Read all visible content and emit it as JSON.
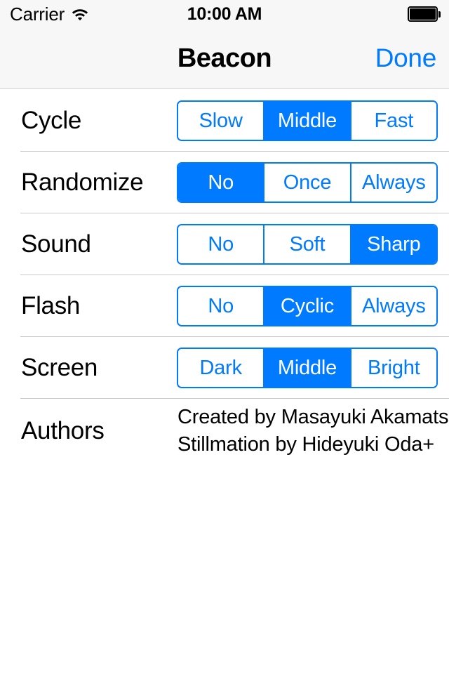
{
  "status_bar": {
    "carrier": "Carrier",
    "wifi_icon": "wifi-icon",
    "time": "10:00 AM",
    "battery_icon": "battery-full-icon"
  },
  "nav_bar": {
    "title": "Beacon",
    "done_label": "Done"
  },
  "colors": {
    "accent": "#007AFF",
    "separator": "#C8C7CC",
    "bar_background": "#F7F7F7",
    "text": "#000000"
  },
  "settings": [
    {
      "label": "Cycle",
      "options": [
        "Slow",
        "Middle",
        "Fast"
      ],
      "selected_index": 1,
      "selected_value": "Middle"
    },
    {
      "label": "Randomize",
      "options": [
        "No",
        "Once",
        "Always"
      ],
      "selected_index": 0,
      "selected_value": "No"
    },
    {
      "label": "Sound",
      "options": [
        "No",
        "Soft",
        "Sharp"
      ],
      "selected_index": 2,
      "selected_value": "Sharp"
    },
    {
      "label": "Flash",
      "options": [
        "No",
        "Cyclic",
        "Always"
      ],
      "selected_index": 1,
      "selected_value": "Cyclic"
    },
    {
      "label": "Screen",
      "options": [
        "Dark",
        "Middle",
        "Bright"
      ],
      "selected_index": 1,
      "selected_value": "Middle"
    }
  ],
  "authors": {
    "label": "Authors",
    "lines": [
      "Created by Masayuki Akamatsu",
      "Stillmation by Hideyuki Oda+"
    ]
  }
}
